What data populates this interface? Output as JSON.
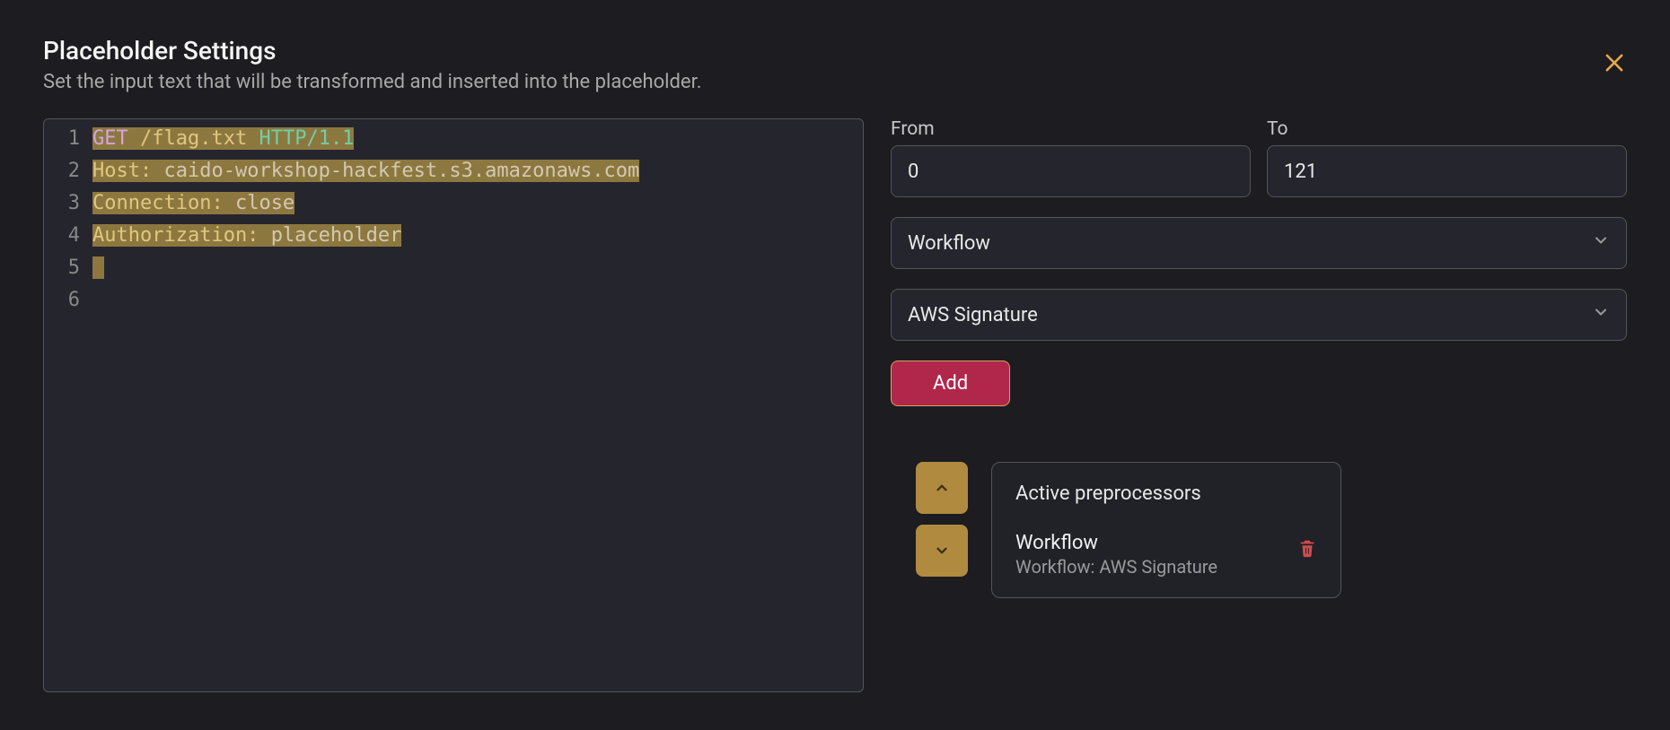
{
  "header": {
    "title": "Placeholder Settings",
    "subtitle": "Set the input text that will be transformed and inserted into the placeholder."
  },
  "editor": {
    "lines": [
      {
        "n": "1",
        "tokens": [
          {
            "t": "GET",
            "cls": "tok-method"
          },
          {
            "t": " ",
            "cls": ""
          },
          {
            "t": "/flag.txt",
            "cls": "tok-path"
          },
          {
            "t": " ",
            "cls": ""
          },
          {
            "t": "HTTP/1.1",
            "cls": "tok-proto"
          }
        ],
        "hl": true
      },
      {
        "n": "2",
        "tokens": [
          {
            "t": "Host:",
            "cls": "tok-header"
          },
          {
            "t": " ",
            "cls": ""
          },
          {
            "t": "caido-workshop-hackfest.s3.amazonaws.com",
            "cls": "tok-value"
          }
        ],
        "hl": true
      },
      {
        "n": "3",
        "tokens": [
          {
            "t": "Connection:",
            "cls": "tok-header"
          },
          {
            "t": " ",
            "cls": ""
          },
          {
            "t": "close",
            "cls": "tok-value"
          }
        ],
        "hl": true
      },
      {
        "n": "4",
        "tokens": [
          {
            "t": "Authorization:",
            "cls": "tok-header"
          },
          {
            "t": " ",
            "cls": ""
          },
          {
            "t": "placeholder",
            "cls": "tok-value"
          }
        ],
        "hl": true
      },
      {
        "n": "5",
        "tokens": [],
        "hl": true
      },
      {
        "n": "6",
        "tokens": [],
        "hl": false
      }
    ]
  },
  "range": {
    "from_label": "From",
    "from_value": "0",
    "to_label": "To",
    "to_value": "121"
  },
  "selects": {
    "workflow": "Workflow",
    "signature": "AWS Signature"
  },
  "buttons": {
    "add": "Add"
  },
  "preprocessors": {
    "title": "Active preprocessors",
    "items": [
      {
        "name": "Workflow",
        "sub": "Workflow: AWS Signature"
      }
    ]
  }
}
